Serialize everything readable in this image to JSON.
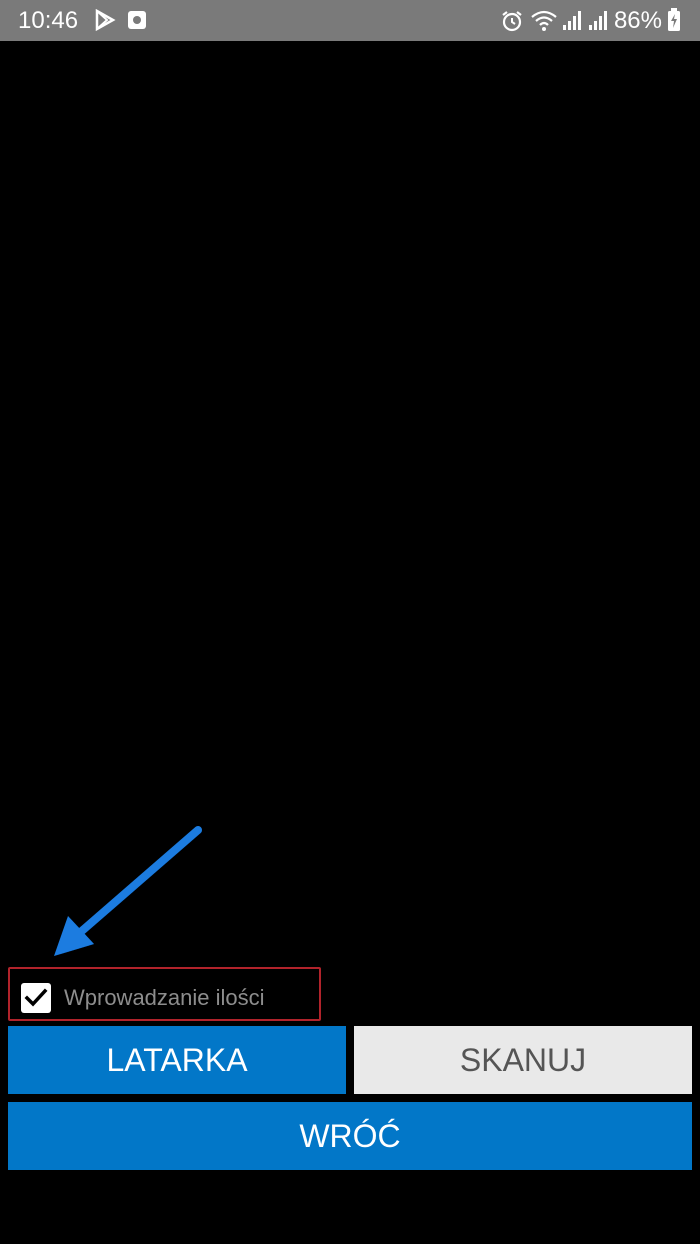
{
  "status_bar": {
    "time": "10:46",
    "battery": "86%"
  },
  "checkbox": {
    "label": "Wprowadzanie ilości",
    "checked": true
  },
  "buttons": {
    "latarka": "LATARKA",
    "skanuj": "SKANUJ",
    "wroc": "WRÓĆ"
  },
  "colors": {
    "primary": "#0277c8",
    "secondary": "#e9e9e9",
    "highlight_border": "#b1232b",
    "annotation_arrow": "#1a7be0"
  }
}
